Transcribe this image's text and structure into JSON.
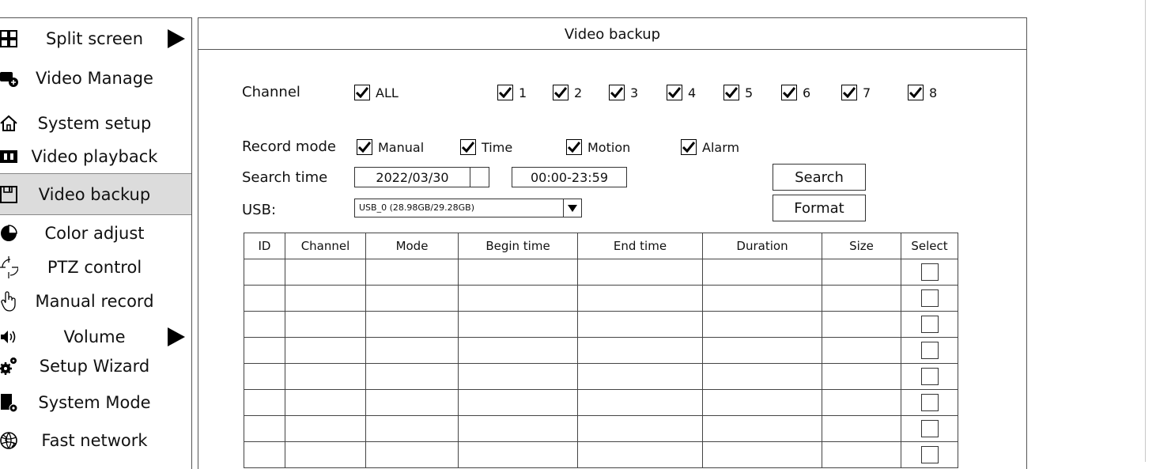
{
  "sidebar": {
    "items": [
      {
        "label": "Split screen",
        "icon": "grid-icon",
        "arrow": true
      },
      {
        "label": "Video Manage",
        "icon": "camera-add-icon"
      },
      {
        "label": "System setup",
        "icon": "home-icon"
      },
      {
        "label": "Video playback",
        "icon": "film-icon"
      },
      {
        "label": "Video backup",
        "icon": "floppy-disk-icon",
        "active": true
      },
      {
        "label": "Color adjust",
        "icon": "pie-icon"
      },
      {
        "label": "PTZ control",
        "icon": "crosshair-icon"
      },
      {
        "label": "Manual record",
        "icon": "hand-pointer-icon"
      },
      {
        "label": "Volume",
        "icon": "speaker-icon",
        "arrow": true
      },
      {
        "label": "Setup Wizard",
        "icon": "gears-icon"
      },
      {
        "label": "System Mode",
        "icon": "device-settings-icon"
      },
      {
        "label": "Fast network",
        "icon": "globe-icon"
      }
    ]
  },
  "panel": {
    "title": "Video backup",
    "channel_label": "Channel",
    "channel_all": "ALL",
    "channels": [
      "1",
      "2",
      "3",
      "4",
      "5",
      "6",
      "7",
      "8"
    ],
    "record_mode_label": "Record mode",
    "record_modes": [
      "Manual",
      "Time",
      "Motion",
      "Alarm"
    ],
    "search_time_label": "Search time",
    "date": "2022/03/30",
    "time_range": "00:00-23:59",
    "search_button": "Search",
    "usb_label": "USB:",
    "usb_value": "USB_0 (28.98GB/29.28GB)",
    "format_button": "Format"
  },
  "table": {
    "headers": [
      "ID",
      "Channel",
      "Mode",
      "Begin time",
      "End time",
      "Duration",
      "Size",
      "Select"
    ],
    "row_count": 8
  }
}
